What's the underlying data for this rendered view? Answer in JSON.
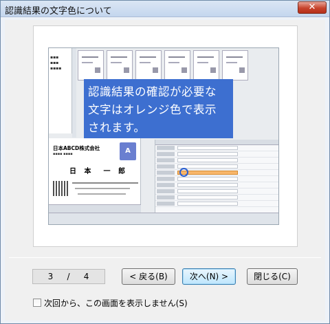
{
  "window": {
    "title": "認識結果の文字色について",
    "close_glyph": "✕"
  },
  "preview": {
    "overlay_lines": [
      "認識結果の確認が必要な",
      "文字はオレンジ色で表示",
      "されます。"
    ],
    "card_company": "日本ABCD株式会社",
    "card_name": "日 本　一 郎"
  },
  "pagination": {
    "current": "3",
    "separator": "/",
    "total": "4"
  },
  "buttons": {
    "back_label": "< 戻る(B)",
    "next_label": "次へ(N) >",
    "close_label": "閉じる(C)"
  },
  "dont_show": {
    "label": "次回から、この画面を表示しません(S)",
    "checked": false
  },
  "colors": {
    "overlay_bg": "#3d6fd0",
    "highlight_orange": "#f8b66b"
  }
}
